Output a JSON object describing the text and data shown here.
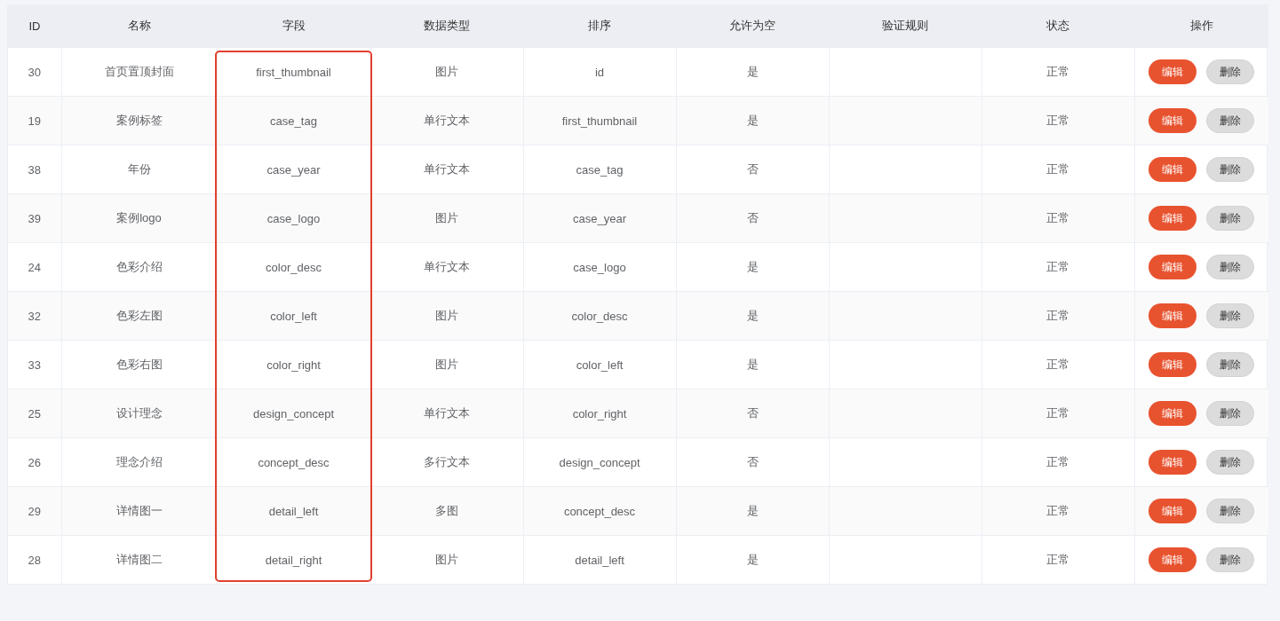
{
  "table": {
    "columns": [
      {
        "label": "ID",
        "highlighted": false
      },
      {
        "label": "名称",
        "highlighted": false
      },
      {
        "label": "字段",
        "highlighted": true
      },
      {
        "label": "数据类型",
        "highlighted": false
      },
      {
        "label": "排序",
        "highlighted": false
      },
      {
        "label": "允许为空",
        "highlighted": false
      },
      {
        "label": "验证规则",
        "highlighted": false
      },
      {
        "label": "状态",
        "highlighted": false
      },
      {
        "label": "操作",
        "highlighted": false
      }
    ],
    "rows": [
      {
        "id": "30",
        "name": "首页置顶封面",
        "field": "first_thumbnail",
        "data_type": "图片",
        "sort": "id",
        "nullable": "是",
        "status": "正常",
        "actions": [
          {
            "label": "编辑",
            "kind": "primary"
          },
          {
            "label": "删除",
            "kind": "default"
          }
        ]
      },
      {
        "id": "19",
        "name": "案例标签",
        "field": "case_tag",
        "data_type": "单行文本",
        "sort": "first_thumbnail",
        "nullable": "是",
        "status": "正常",
        "actions": [
          {
            "label": "编辑",
            "kind": "primary"
          },
          {
            "label": "删除",
            "kind": "default"
          }
        ]
      },
      {
        "id": "38",
        "name": "年份",
        "field": "case_year",
        "data_type": "单行文本",
        "sort": "case_tag",
        "nullable": "否",
        "status": "正常",
        "actions": [
          {
            "label": "编辑",
            "kind": "primary"
          },
          {
            "label": "删除",
            "kind": "default"
          }
        ]
      },
      {
        "id": "39",
        "name": "案例logo",
        "field": "case_logo",
        "data_type": "图片",
        "sort": "case_year",
        "nullable": "否",
        "status": "正常",
        "actions": [
          {
            "label": "编辑",
            "kind": "primary"
          },
          {
            "label": "删除",
            "kind": "default"
          }
        ]
      },
      {
        "id": "24",
        "name": "色彩介绍",
        "field": "color_desc",
        "data_type": "单行文本",
        "sort": "case_logo",
        "nullable": "是",
        "status": "正常",
        "actions": [
          {
            "label": "编辑",
            "kind": "primary"
          },
          {
            "label": "删除",
            "kind": "default"
          }
        ]
      },
      {
        "id": "32",
        "name": "色彩左图",
        "field": "color_left",
        "data_type": "图片",
        "sort": "color_desc",
        "nullable": "是",
        "status": "正常",
        "actions": [
          {
            "label": "编辑",
            "kind": "primary"
          },
          {
            "label": "删除",
            "kind": "default"
          }
        ]
      },
      {
        "id": "33",
        "name": "色彩右图",
        "field": "color_right",
        "data_type": "图片",
        "sort": "color_left",
        "nullable": "是",
        "status": "正常",
        "actions": [
          {
            "label": "编辑",
            "kind": "primary"
          },
          {
            "label": "删除",
            "kind": "default"
          }
        ]
      },
      {
        "id": "25",
        "name": "设计理念",
        "field": "design_concept",
        "data_type": "单行文本",
        "sort": "color_right",
        "nullable": "否",
        "status": "正常",
        "actions": [
          {
            "label": "编辑",
            "kind": "primary"
          },
          {
            "label": "删除",
            "kind": "default"
          }
        ]
      },
      {
        "id": "26",
        "name": "理念介绍",
        "field": "concept_desc",
        "data_type": "多行文本",
        "sort": "design_concept",
        "nullable": "否",
        "status": "正常",
        "actions": [
          {
            "label": "编辑",
            "kind": "primary"
          },
          {
            "label": "删除",
            "kind": "default"
          }
        ]
      },
      {
        "id": "29",
        "name": "详情图一",
        "field": "detail_left",
        "data_type": "多图",
        "sort": "concept_desc",
        "nullable": "是",
        "status": "正常",
        "actions": [
          {
            "label": "编辑",
            "kind": "primary"
          },
          {
            "label": "删除",
            "kind": "default"
          }
        ]
      },
      {
        "id": "28",
        "name": "详情图二",
        "field": "detail_right",
        "data_type": "图片",
        "sort": "detail_left",
        "nullable": "是",
        "status": "正常",
        "actions": [
          {
            "label": "编辑",
            "kind": "primary"
          },
          {
            "label": "删除",
            "kind": "default"
          }
        ]
      }
    ]
  }
}
